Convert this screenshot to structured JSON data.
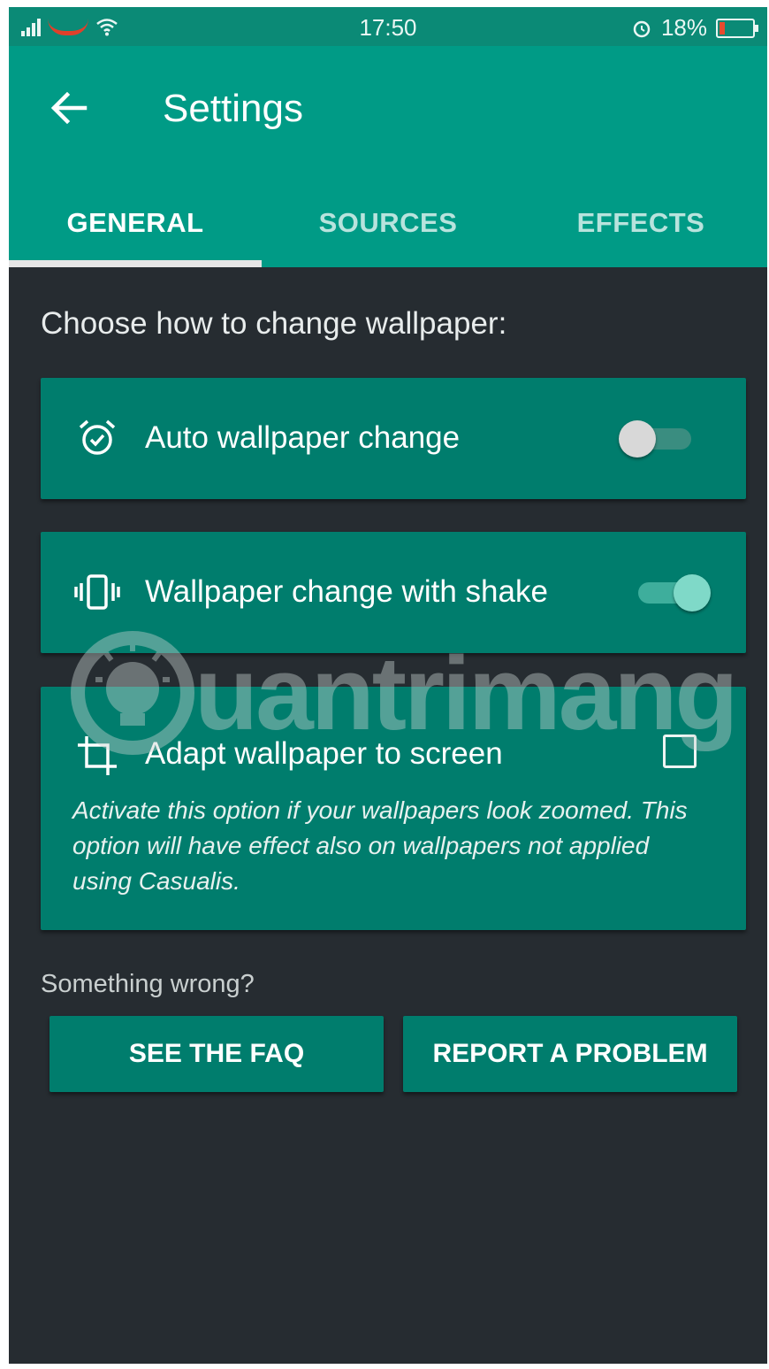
{
  "status_bar": {
    "time": "17:50",
    "battery_percent": "18%",
    "battery_level": 0.18,
    "icons": [
      "signal-icon",
      "wifi-icon",
      "alarm-icon",
      "battery-icon"
    ]
  },
  "app_bar": {
    "title": "Settings",
    "back_icon": "arrow-left-icon",
    "color": "#009b86"
  },
  "tabs": [
    {
      "label": "GENERAL",
      "active": true
    },
    {
      "label": "SOURCES",
      "active": false
    },
    {
      "label": "EFFECTS",
      "active": false
    }
  ],
  "main": {
    "section_title": "Choose how to change wallpaper:",
    "options": [
      {
        "icon": "alarm-clock-icon",
        "label": "Auto wallpaper change",
        "control": "switch",
        "on": false
      },
      {
        "icon": "vibrate-phone-icon",
        "label": "Wallpaper change with shake",
        "control": "switch",
        "on": true
      },
      {
        "icon": "crop-icon",
        "label": "Adapt wallpaper to screen",
        "control": "checkbox",
        "checked": false,
        "description": "Activate this option if your wallpapers look zoomed. This option will have effect also on wallpapers not applied using Casualis."
      }
    ]
  },
  "help": {
    "label": "Something wrong?",
    "faq_button": "SEE THE FAQ",
    "report_button": "REPORT A PROBLEM"
  },
  "watermark": {
    "text": "uantrimang"
  },
  "colors": {
    "accent": "#009b86",
    "card": "#007d6d",
    "background": "#262c31"
  }
}
